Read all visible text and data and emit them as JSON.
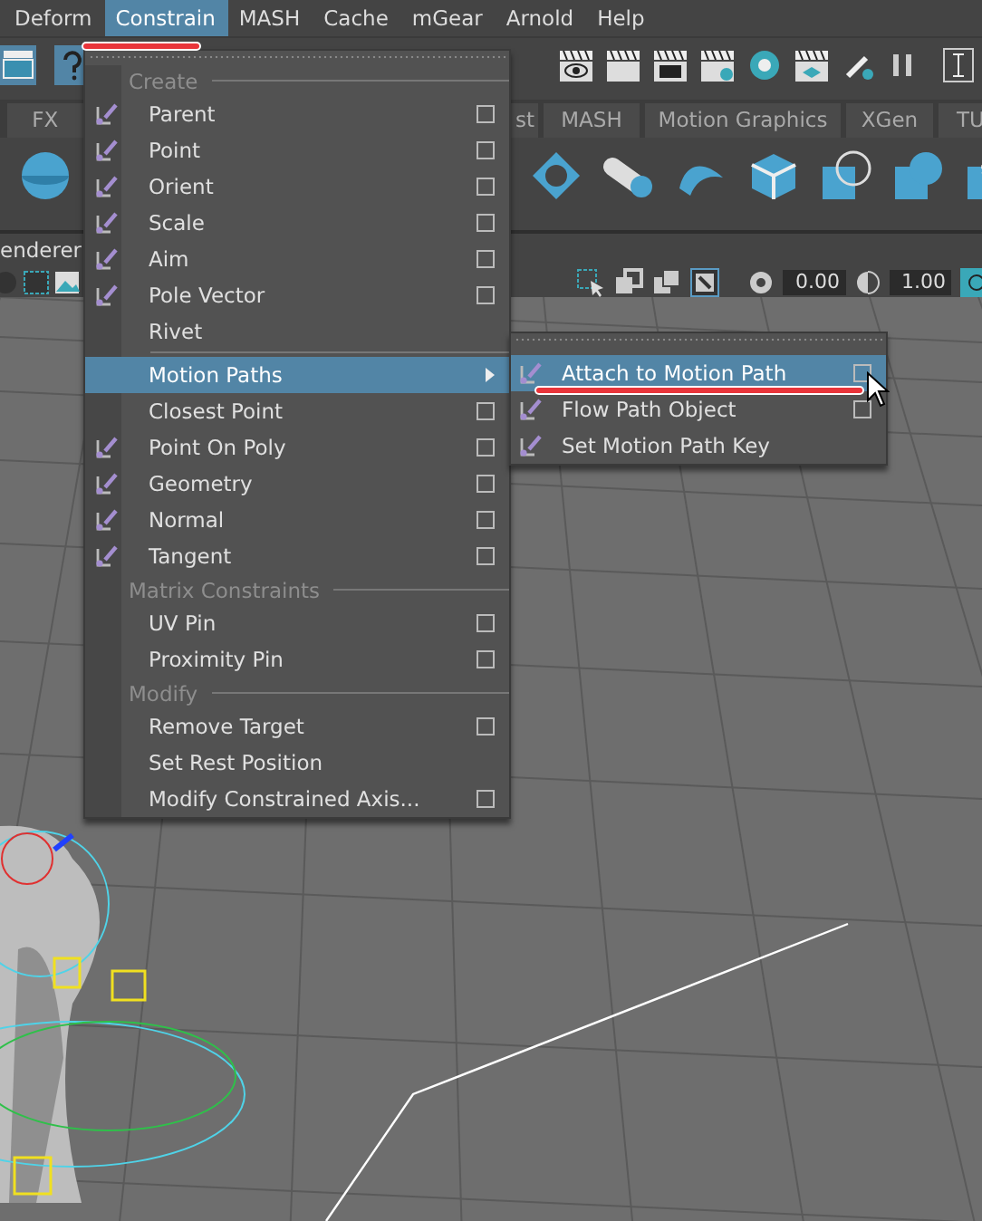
{
  "menubar": {
    "items": [
      {
        "label": "Deform",
        "selected": false
      },
      {
        "label": "Constrain",
        "selected": true
      },
      {
        "label": "MASH",
        "selected": false
      },
      {
        "label": "Cache",
        "selected": false
      },
      {
        "label": "mGear",
        "selected": false
      },
      {
        "label": "Arnold",
        "selected": false
      },
      {
        "label": "Help",
        "selected": false
      }
    ]
  },
  "shelf_tabs": [
    {
      "label": "FX",
      "selected": false
    },
    {
      "label": "st",
      "selected": false
    },
    {
      "label": "MASH",
      "selected": false
    },
    {
      "label": "Motion Graphics",
      "selected": false
    },
    {
      "label": "XGen",
      "selected": false
    },
    {
      "label": "TU",
      "selected": false
    }
  ],
  "panel": {
    "label": "enderer",
    "fields": [
      "0.00",
      "1.00"
    ]
  },
  "menu": {
    "items": [
      {
        "kind": "header",
        "label": "Create"
      },
      {
        "kind": "item",
        "label": "Parent",
        "icon": true,
        "option_box": true,
        "selected": false
      },
      {
        "kind": "item",
        "label": "Point",
        "icon": true,
        "option_box": true,
        "selected": false
      },
      {
        "kind": "item",
        "label": "Orient",
        "icon": true,
        "option_box": true,
        "selected": false
      },
      {
        "kind": "item",
        "label": "Scale",
        "icon": true,
        "option_box": true,
        "selected": false
      },
      {
        "kind": "item",
        "label": "Aim",
        "icon": true,
        "option_box": true,
        "selected": false
      },
      {
        "kind": "item",
        "label": "Pole Vector",
        "icon": true,
        "option_box": true,
        "selected": false
      },
      {
        "kind": "item",
        "label": "Rivet",
        "icon": false,
        "option_box": false,
        "selected": false
      },
      {
        "kind": "separator"
      },
      {
        "kind": "submenu",
        "label": "Motion Paths",
        "icon": false,
        "selected": true
      },
      {
        "kind": "item",
        "label": "Closest Point",
        "icon": false,
        "option_box": true,
        "selected": false
      },
      {
        "kind": "item",
        "label": "Point On Poly",
        "icon": true,
        "option_box": true,
        "selected": false
      },
      {
        "kind": "item",
        "label": "Geometry",
        "icon": true,
        "option_box": true,
        "selected": false
      },
      {
        "kind": "item",
        "label": "Normal",
        "icon": true,
        "option_box": true,
        "selected": false
      },
      {
        "kind": "item",
        "label": "Tangent",
        "icon": true,
        "option_box": true,
        "selected": false
      },
      {
        "kind": "header",
        "label": "Matrix Constraints"
      },
      {
        "kind": "item",
        "label": "UV Pin",
        "icon": false,
        "option_box": true,
        "selected": false
      },
      {
        "kind": "item",
        "label": "Proximity Pin",
        "icon": false,
        "option_box": true,
        "selected": false
      },
      {
        "kind": "header",
        "label": "Modify"
      },
      {
        "kind": "item",
        "label": "Remove Target",
        "icon": false,
        "option_box": true,
        "selected": false
      },
      {
        "kind": "item",
        "label": "Set Rest Position",
        "icon": false,
        "option_box": false,
        "selected": false
      },
      {
        "kind": "item",
        "label": "Modify Constrained Axis...",
        "icon": false,
        "option_box": true,
        "selected": false
      }
    ]
  },
  "submenu": {
    "items": [
      {
        "kind": "item",
        "label": "Attach to Motion Path",
        "icon": true,
        "option_box": true,
        "selected": true
      },
      {
        "kind": "item",
        "label": "Flow Path Object",
        "icon": true,
        "option_box": true,
        "selected": false
      },
      {
        "kind": "item",
        "label": "Set Motion Path Key",
        "icon": true,
        "option_box": false,
        "selected": false
      }
    ]
  }
}
